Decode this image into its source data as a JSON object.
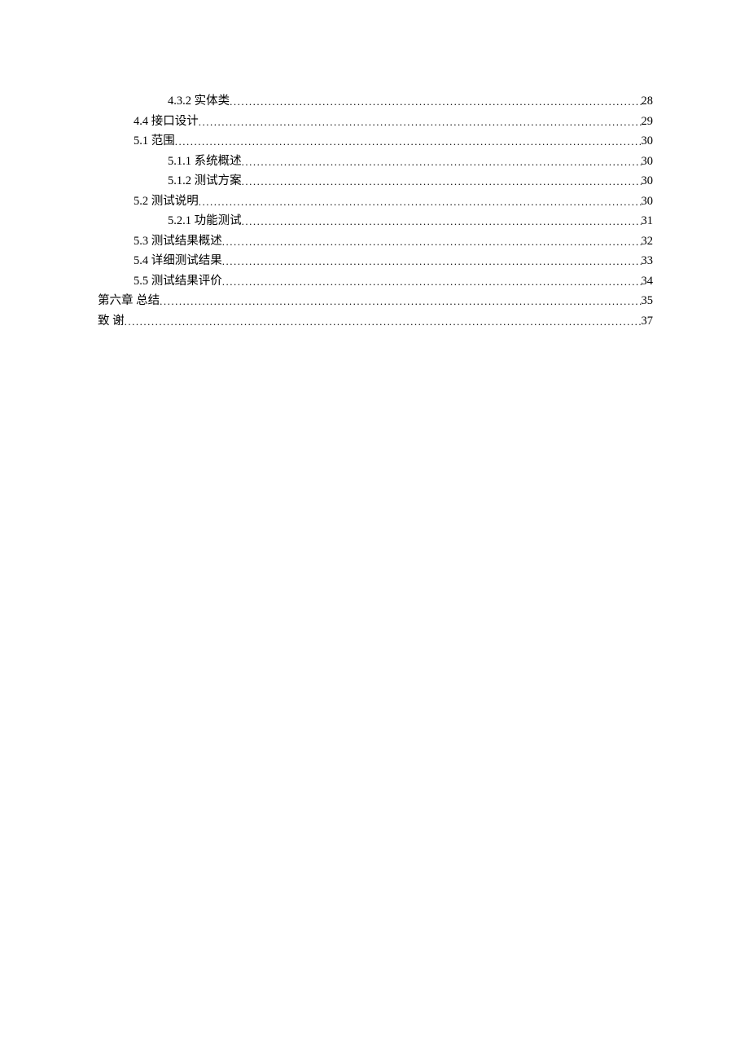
{
  "toc": {
    "entries": [
      {
        "level": 2,
        "number": "4.3.2",
        "title": "实体类",
        "page": "28"
      },
      {
        "level": 1,
        "number": "4.4",
        "title": "接口设计",
        "page": "29"
      },
      {
        "level": 1,
        "number": "5.1",
        "title": "范围",
        "page": "30"
      },
      {
        "level": 2,
        "number": "5.1.1",
        "title": "系统概述",
        "page": "30"
      },
      {
        "level": 2,
        "number": "5.1.2",
        "title": "测试方案",
        "page": "30"
      },
      {
        "level": 1,
        "number": "5.2",
        "title": "测试说明",
        "page": "30"
      },
      {
        "level": 2,
        "number": "5.2.1",
        "title": "功能测试",
        "page": "31"
      },
      {
        "level": 1,
        "number": "5.3",
        "title": "测试结果概述",
        "page": "32"
      },
      {
        "level": 1,
        "number": "5.4",
        "title": "详细测试结果",
        "page": "33"
      },
      {
        "level": 1,
        "number": "5.5",
        "title": "测试结果评价",
        "page": "34"
      },
      {
        "level": 0,
        "number": "第六章",
        "title": "总结",
        "page": "35"
      },
      {
        "level": 0,
        "number": "",
        "title": "致 谢",
        "page": "37"
      }
    ]
  }
}
